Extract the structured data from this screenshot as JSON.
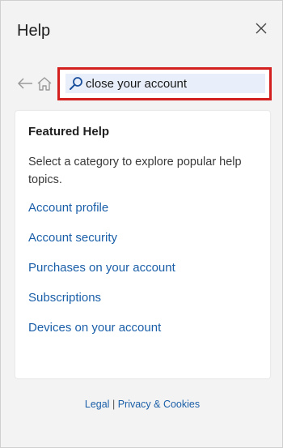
{
  "header": {
    "title": "Help",
    "close_icon": "close-icon"
  },
  "nav": {
    "back_icon": "back-arrow-icon",
    "home_icon": "home-icon"
  },
  "search": {
    "value": "close your account",
    "icon": "search-icon",
    "highlight_color": "#d41f1f"
  },
  "featured": {
    "title": "Featured Help",
    "description": "Select a category to explore popular help topics.",
    "links": [
      "Account profile",
      "Account security",
      "Purchases on your account",
      "Subscriptions",
      "Devices on your account"
    ]
  },
  "footer": {
    "legal": "Legal",
    "separator": "|",
    "privacy": "Privacy & Cookies"
  },
  "colors": {
    "link": "#1b5fa8",
    "panel_bg": "#f3f3f3"
  }
}
